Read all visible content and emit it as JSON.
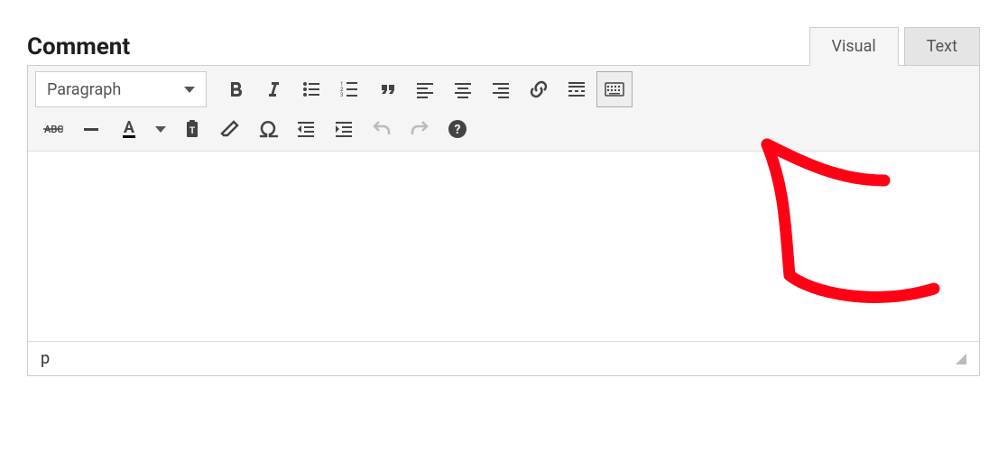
{
  "title": "Comment",
  "tabs": {
    "visual": "Visual",
    "text": "Text"
  },
  "format_selector": {
    "value": "Paragraph"
  },
  "toolbar_row1": [
    {
      "name": "bold-button",
      "icon": "bold"
    },
    {
      "name": "italic-button",
      "icon": "italic"
    },
    {
      "name": "bullet-list-button",
      "icon": "ul"
    },
    {
      "name": "numbered-list-button",
      "icon": "ol"
    },
    {
      "name": "blockquote-button",
      "icon": "quote"
    },
    {
      "name": "align-left-button",
      "icon": "alignleft"
    },
    {
      "name": "align-center-button",
      "icon": "aligncenter"
    },
    {
      "name": "align-right-button",
      "icon": "alignright"
    },
    {
      "name": "insert-link-button",
      "icon": "link"
    },
    {
      "name": "insert-more-button",
      "icon": "more"
    },
    {
      "name": "toggle-toolbar-button",
      "icon": "keyboard",
      "boxed": true
    }
  ],
  "toolbar_row2": [
    {
      "name": "strikethrough-button",
      "icon": "strike"
    },
    {
      "name": "horizontal-rule-button",
      "icon": "hr"
    },
    {
      "name": "text-color-button",
      "icon": "textcolor"
    },
    {
      "name": "text-color-dropdown",
      "icon": "caret"
    },
    {
      "name": "paste-text-button",
      "icon": "paste"
    },
    {
      "name": "clear-formatting-button",
      "icon": "clear"
    },
    {
      "name": "special-character-button",
      "icon": "omega"
    },
    {
      "name": "outdent-button",
      "icon": "outdent"
    },
    {
      "name": "indent-button",
      "icon": "indent"
    },
    {
      "name": "undo-button",
      "icon": "undo",
      "disabled": true
    },
    {
      "name": "redo-button",
      "icon": "redo",
      "disabled": true
    },
    {
      "name": "help-button",
      "icon": "help"
    }
  ],
  "editor": {
    "content": ""
  },
  "status_path": "p"
}
